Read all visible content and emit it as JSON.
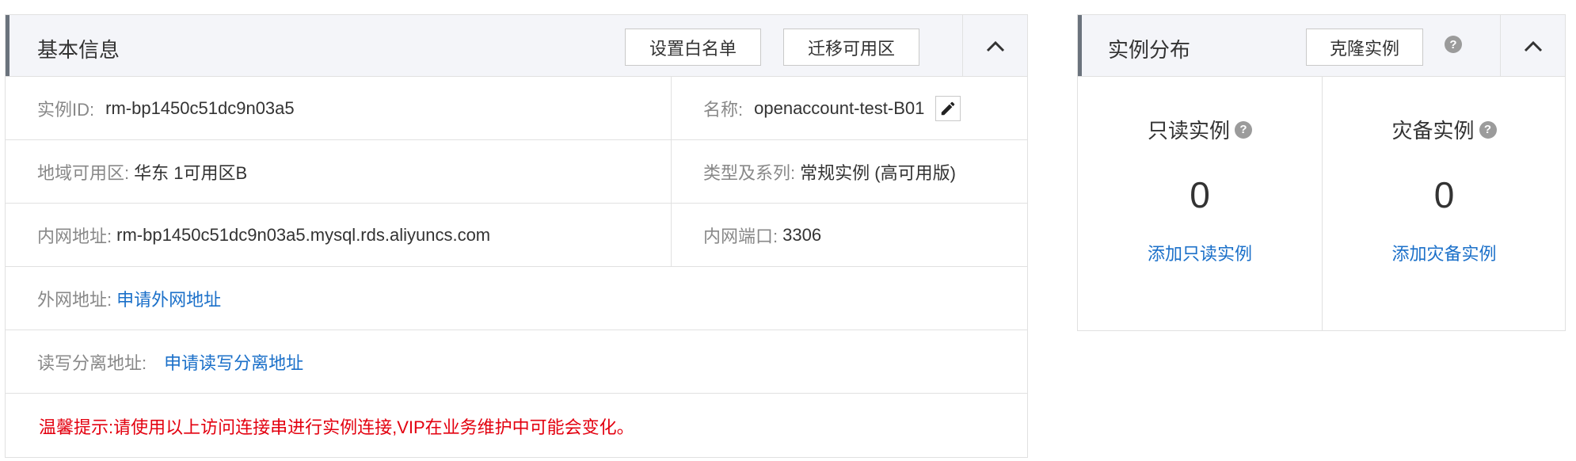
{
  "basic_info": {
    "title": "基本信息",
    "whitelist_button": "设置白名单",
    "migrate_button": "迁移可用区",
    "rows": {
      "instance_id": {
        "label": "实例ID:",
        "value": "rm-bp1450c51dc9n03a5"
      },
      "name": {
        "label": "名称:",
        "value": "openaccount-test-B01"
      },
      "region_zone": {
        "label": "地域可用区:",
        "value": "华东 1可用区B"
      },
      "type_series": {
        "label": "类型及系列:",
        "value": "常规实例 (高可用版)"
      },
      "intranet_address": {
        "label": "内网地址:",
        "value": "rm-bp1450c51dc9n03a5.mysql.rds.aliyuncs.com"
      },
      "intranet_port": {
        "label": "内网端口:",
        "value": "3306"
      },
      "internet_address": {
        "label": "外网地址:",
        "link": "申请外网地址"
      },
      "rw_split_address": {
        "label": "读写分离地址:",
        "link": "申请读写分离地址"
      }
    },
    "tip": "温馨提示:请使用以上访问连接串进行实例连接,VIP在业务维护中可能会变化。"
  },
  "distribution": {
    "title": "实例分布",
    "clone_button": "克隆实例",
    "help_glyph": "?",
    "readonly": {
      "title": "只读实例",
      "count": "0",
      "link": "添加只读实例"
    },
    "disaster": {
      "title": "灾备实例",
      "count": "0",
      "link": "添加灾备实例"
    }
  },
  "colors": {
    "link": "#1b70c9",
    "warning": "#e3000f",
    "header_bg": "#f4f5f9",
    "accent_bar": "#6b737d"
  },
  "icons": [
    "chevron-up-icon",
    "pencil-icon",
    "help-icon"
  ]
}
